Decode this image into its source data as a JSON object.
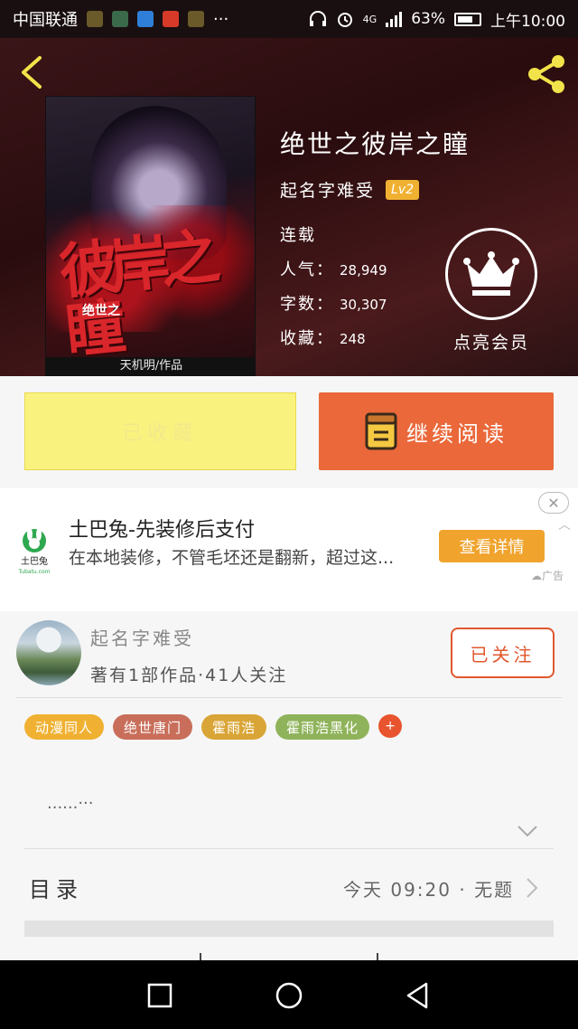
{
  "status_bar": {
    "carrier": "中国联通",
    "ellipsis": "···",
    "network": "4G",
    "battery": "63%",
    "time": "上午10:00"
  },
  "book": {
    "title": "绝世之彼岸之瞳",
    "author": "起名字难受",
    "level": "Lv2",
    "status": "连载",
    "popularity_label": "人气：",
    "popularity": "28,949",
    "wordcount_label": "字数：",
    "wordcount": "30,307",
    "favorites_label": "收藏：",
    "favorites": "248",
    "vip_label": "点亮会员",
    "cover": {
      "title": "彼岸之瞳",
      "subtitle": "绝世之",
      "author_credit": "天机明/作品"
    }
  },
  "actions": {
    "favorited_label": "已收藏",
    "continue_label": "继续阅读"
  },
  "ad": {
    "title": "土巴兔-先装修后支付",
    "description": "在本地装修，不管毛坯还是翻新，超过这...",
    "cta": "查看详情",
    "tag": "广告",
    "logo_text": "土巴兔",
    "logo_url_text": "Tubatu.com"
  },
  "author_panel": {
    "name": "起名字难受",
    "stats": "著有1部作品·41人关注",
    "follow_label": "已关注",
    "tags": [
      {
        "label": "动漫同人",
        "color": "#f0b132"
      },
      {
        "label": "绝世唐门",
        "color": "#c86e5a"
      },
      {
        "label": "霍雨浩",
        "color": "#d9a536"
      },
      {
        "label": "霍雨浩黑化",
        "color": "#8fb35a"
      }
    ],
    "add_tag": "+",
    "intro": "......···"
  },
  "toc": {
    "label": "目录",
    "latest": "今天 09:20 · 无题"
  },
  "colors": {
    "accent_orange": "#ea683a",
    "favorite_yellow": "#faf27f",
    "vip_gold": "#f0b132"
  },
  "icons": {
    "back": "chevron-left-icon",
    "share": "share-icon",
    "vip": "crown-icon",
    "book": "book-icon",
    "nav_recent": "square-icon",
    "nav_home": "circle-icon",
    "nav_back": "triangle-back-icon"
  }
}
